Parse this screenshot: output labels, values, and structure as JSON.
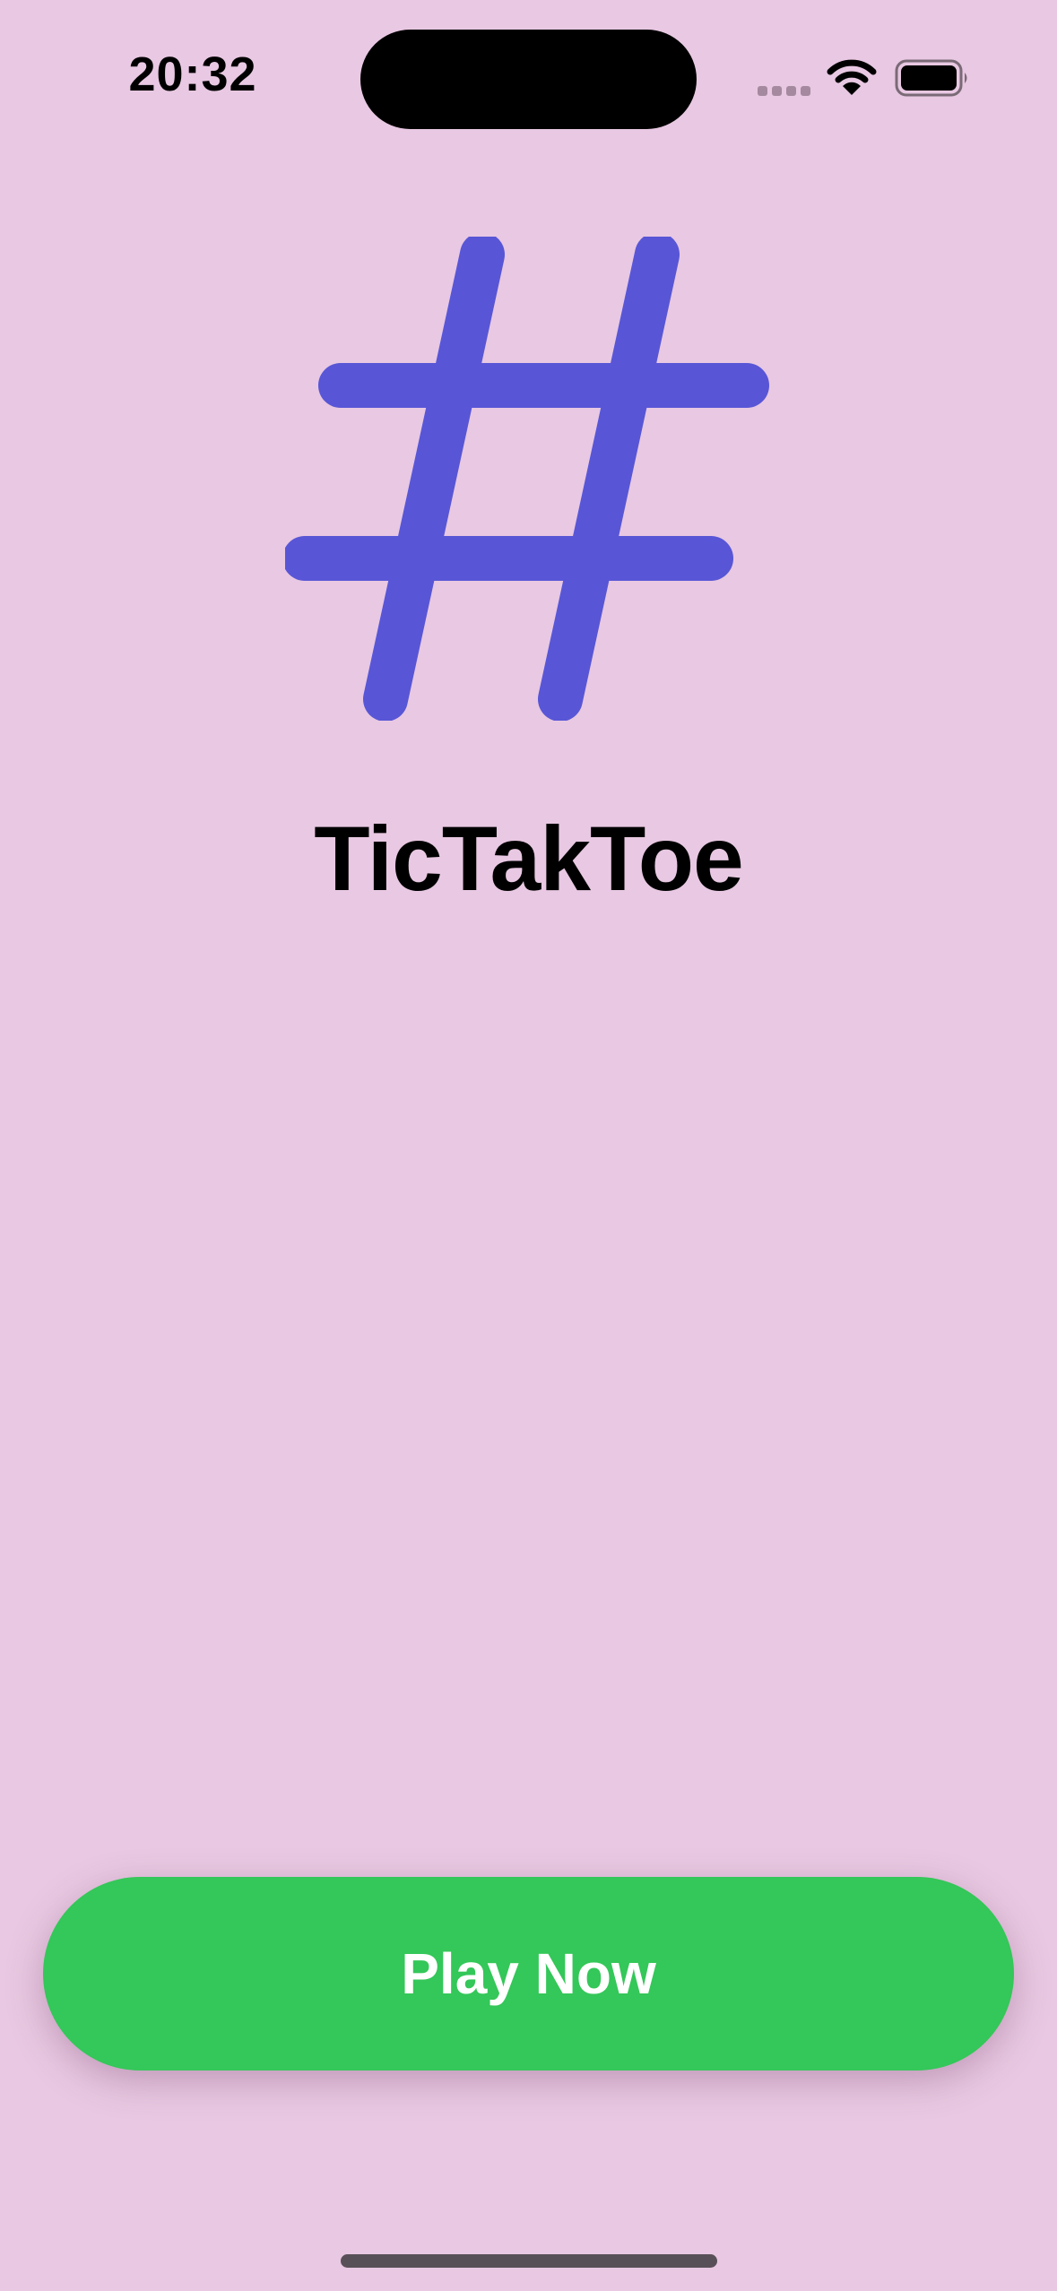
{
  "status_bar": {
    "time": "20:32",
    "wifi_icon": "wifi-icon",
    "battery_icon": "battery-full-icon",
    "signal_icon": "cellular-signal-icon"
  },
  "logo": {
    "icon": "number-sign-icon",
    "color": "#5856d6"
  },
  "title": "TicTakToe",
  "play_button": {
    "label": "Play Now",
    "color": "#34c759"
  },
  "colors": {
    "background": "#e8c8e2",
    "accent": "#5856d6",
    "button": "#34c759"
  }
}
